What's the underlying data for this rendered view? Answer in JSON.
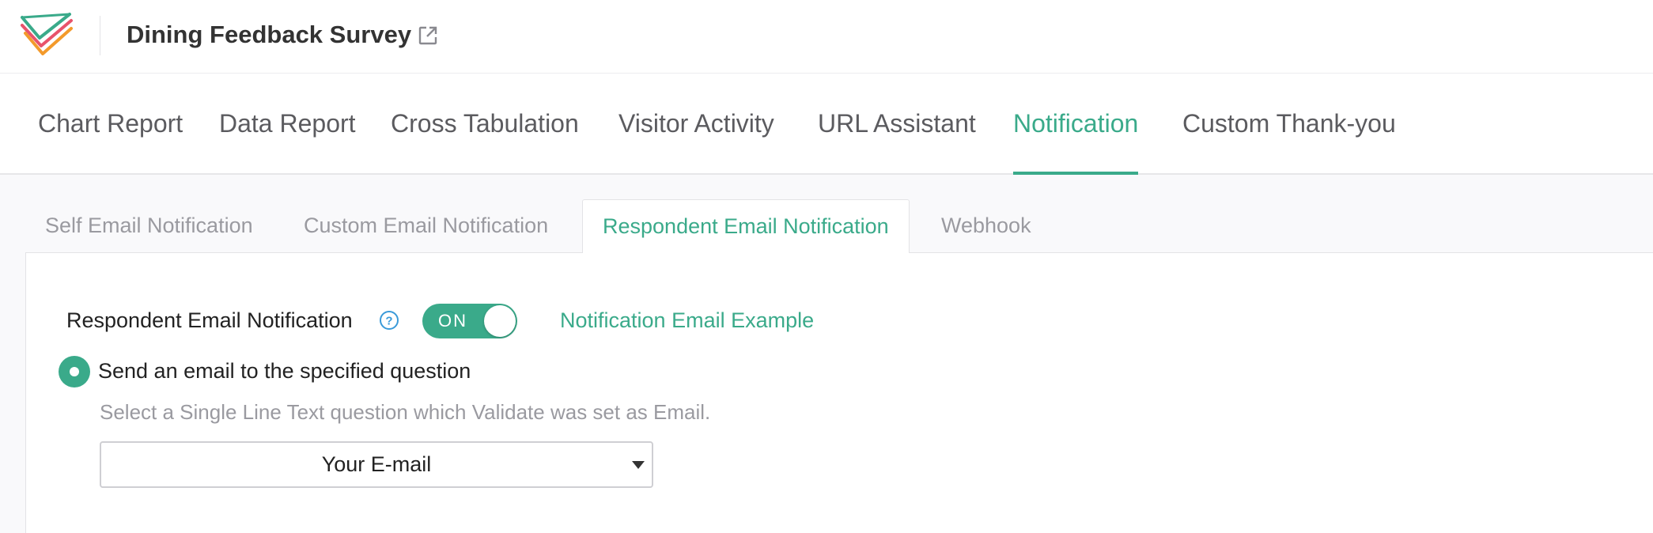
{
  "header": {
    "title": "Dining Feedback Survey",
    "logo_icon": "checkmark-logo-icon",
    "open_icon": "external-link-icon"
  },
  "main_tabs": [
    {
      "label": "Chart Report",
      "active": false
    },
    {
      "label": "Data Report",
      "active": false
    },
    {
      "label": "Cross Tabulation",
      "active": false
    },
    {
      "label": "Visitor Activity",
      "active": false
    },
    {
      "label": "URL Assistant",
      "active": false
    },
    {
      "label": "Notification",
      "active": true
    },
    {
      "label": "Custom Thank-you",
      "active": false
    }
  ],
  "sub_tabs": [
    {
      "label": "Self Email Notification",
      "active": false
    },
    {
      "label": "Custom Email Notification",
      "active": false
    },
    {
      "label": "Respondent Email Notification",
      "active": true
    },
    {
      "label": "Webhook",
      "active": false
    }
  ],
  "panel": {
    "notification_label": "Respondent Email Notification",
    "help_icon": "question-circle-icon",
    "toggle": {
      "state": "ON",
      "on": true
    },
    "example_link": "Notification Email Example",
    "radio_label": "Send an email to the specified question",
    "radio_selected": true,
    "hint": "Select a Single Line Text question which Validate was set as Email.",
    "select": {
      "value": "Your E-mail"
    }
  },
  "colors": {
    "accent": "#3aaa8a",
    "text_dark": "#222222",
    "text_muted": "#9a9aa0",
    "background": "#f9f9fb"
  }
}
